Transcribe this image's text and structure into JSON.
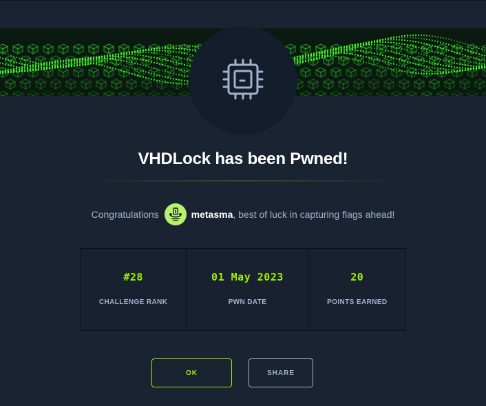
{
  "modal": {
    "title": "VHDLock has been Pwned!",
    "congrats_prefix": "Congratulations",
    "username": "metasma",
    "congrats_suffix": ", best of luck in capturing flags ahead!",
    "icon": "cpu-chip-icon",
    "avatar_icon": "user-avatar-icon"
  },
  "stats": [
    {
      "value": "#28",
      "label": "CHALLENGE RANK"
    },
    {
      "value": "01 May 2023",
      "label": "PWN DATE"
    },
    {
      "value": "20",
      "label": "POINTS EARNED"
    }
  ],
  "buttons": {
    "ok": "OK",
    "share": "SHARE"
  },
  "colors": {
    "accent": "#9fef00",
    "background": "#1a2332",
    "muted_text": "#a4b1cd",
    "avatar_bg": "#b7f26b"
  }
}
